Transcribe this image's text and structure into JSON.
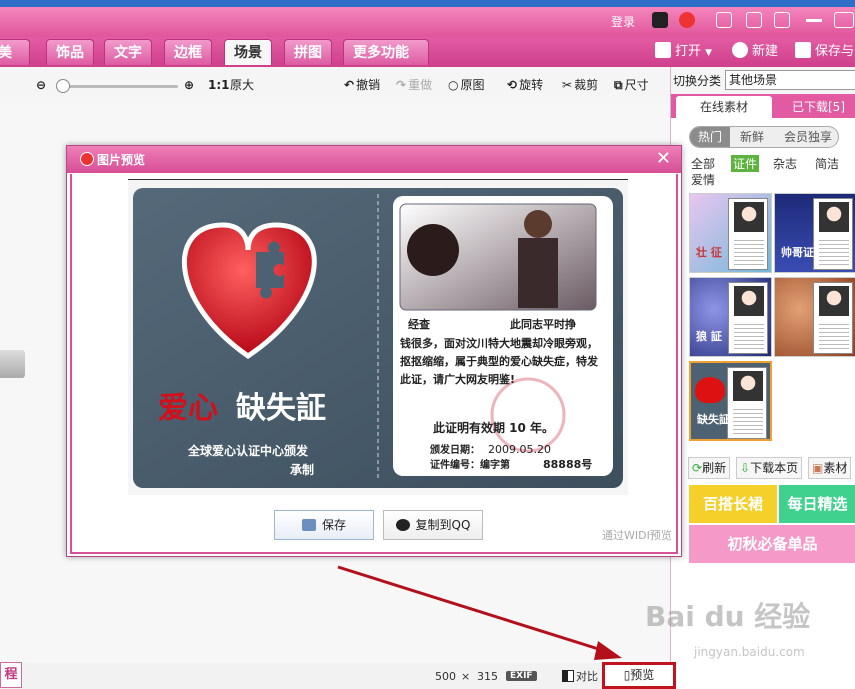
{
  "titlebar": {
    "login": "登录"
  },
  "tabs": [
    "美容",
    "饰品",
    "文字",
    "边框",
    "场景",
    "拼图",
    "更多功能"
  ],
  "tab_active": "场景",
  "top_buttons": {
    "open": "打开",
    "new": "新建",
    "save": "保存与分"
  },
  "toolbar": {
    "ratio": "1:1",
    "original_size": "原大",
    "undo": "撤销",
    "redo": "重做",
    "original": "原图",
    "rotate": "旋转",
    "crop": "裁剪",
    "size": "尺寸"
  },
  "right_panel": {
    "switch_label": "切换分类",
    "switch_value": "其他场景",
    "tabs": [
      "在线素材",
      "已下载[5]"
    ],
    "pills": [
      "热门",
      "新鲜",
      "会员独享"
    ],
    "categories": [
      "全部",
      "证件",
      "杂志",
      "简洁",
      "爱情"
    ],
    "category_active": "证件",
    "thumb_words": [
      "壮 征",
      "帅哥证",
      "狼 証",
      "",
      "缺失証",
      ""
    ],
    "buttons": [
      "刷新",
      "下载本页",
      "素材"
    ],
    "banners": [
      "百搭长裙",
      "每日精选",
      "初秋必备单品"
    ]
  },
  "dialog": {
    "title": "图片预览",
    "save": "保存",
    "copy_qq": "复制到QQ",
    "footer_note": "通过WIDI预览",
    "card": {
      "big_title_red": "爱心",
      "big_title_white": "缺失証",
      "issuer": "全球爱心认证中心颁发",
      "issuer2": "承制",
      "header_left": "经查",
      "header_right": "此同志平时挣",
      "body": "钱很多，面对汶川特大地震却冷眼旁观，抠抠缩缩，属于典型的爱心缺失症，特发此证，请广大网友明鉴!",
      "valid": "此证明有效期  10 年。",
      "issue_date_label": "颁发日期：",
      "issue_date": "2009.05.20",
      "cert_label": "证件编号：编字第",
      "cert_no": "88888号"
    }
  },
  "status": {
    "dims_w": "500",
    "x": "×",
    "dims_h": "315",
    "exif": "EXIF",
    "compare": "对比",
    "preview": "预览"
  },
  "left_button": "程",
  "watermark": {
    "brand": "Bai du 经验",
    "url": "jingyan.baidu.com"
  },
  "colors": {
    "pink": "#e25aa2",
    "dark_pink": "#cf3f8c",
    "highlight": "#c1121f",
    "card": "#4c6272"
  }
}
